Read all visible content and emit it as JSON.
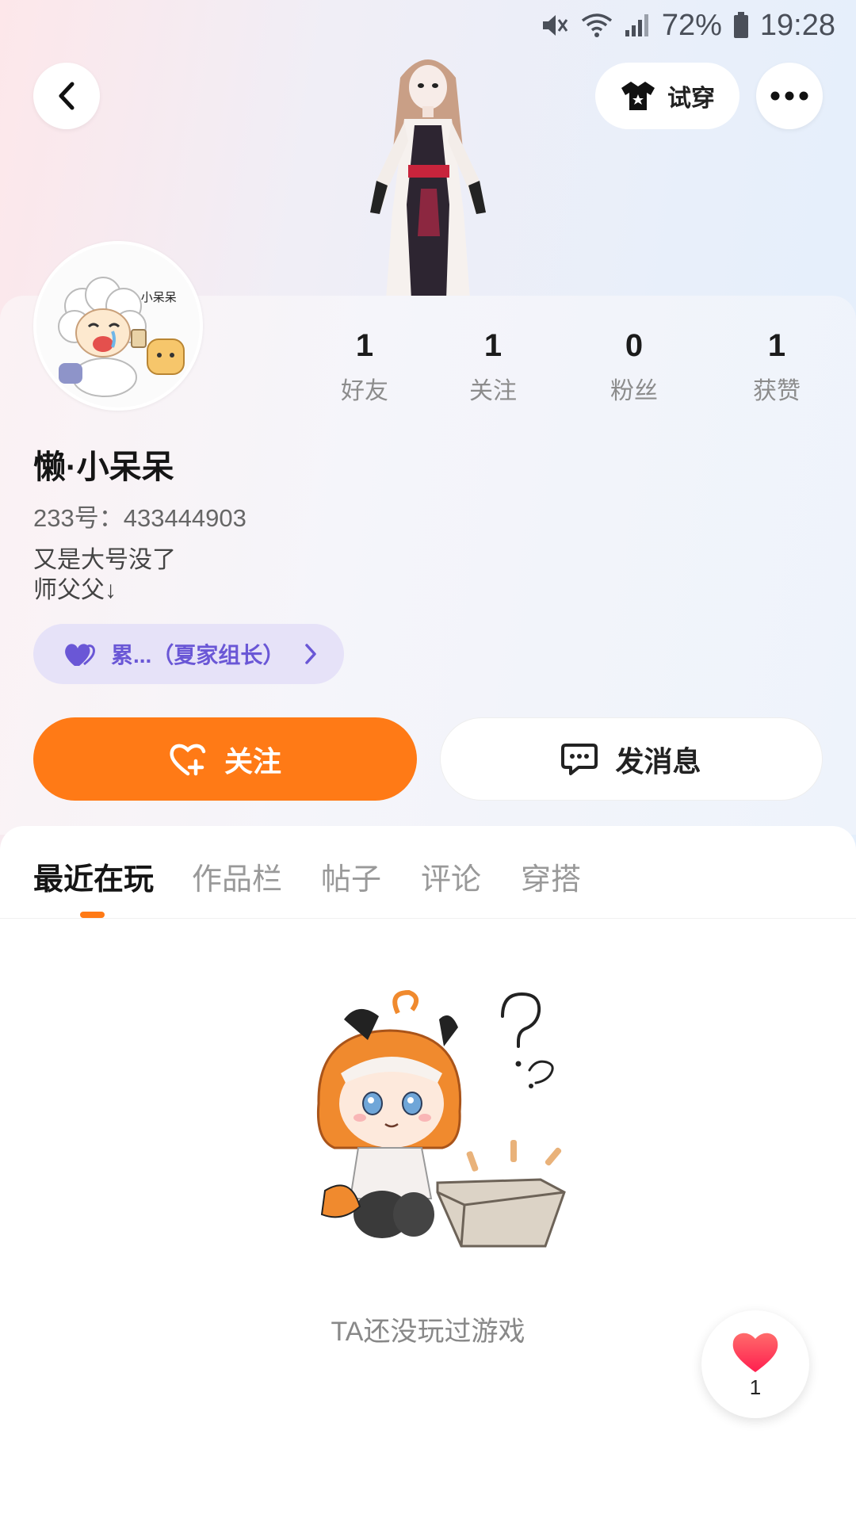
{
  "status_bar": {
    "battery": "72%",
    "time": "19:28",
    "network": "4G"
  },
  "header": {
    "try_on_label": "试穿"
  },
  "profile": {
    "stats": [
      {
        "value": "1",
        "label": "好友"
      },
      {
        "value": "1",
        "label": "关注"
      },
      {
        "value": "0",
        "label": "粉丝"
      },
      {
        "value": "1",
        "label": "获赞"
      }
    ],
    "nickname": "懒·小呆呆",
    "uid_text": "233号：433444903",
    "bio_line1": "又是大号没了",
    "bio_line2": "师父父↓",
    "family_tag": "累...（夏家组长）",
    "avatar_caption": "懒 • 小呆呆"
  },
  "actions": {
    "follow_label": "关注",
    "message_label": "发消息"
  },
  "tabs": [
    {
      "label": "最近在玩",
      "active": true
    },
    {
      "label": "作品栏",
      "active": false
    },
    {
      "label": "帖子",
      "active": false
    },
    {
      "label": "评论",
      "active": false
    },
    {
      "label": "穿搭",
      "active": false
    }
  ],
  "empty_state": {
    "text": "TA还没玩过游戏"
  },
  "floating_like": {
    "count": "1"
  },
  "colors": {
    "accent": "#ff7a16",
    "family": "#6a57d6",
    "family_bg": "#e6e2f8"
  }
}
